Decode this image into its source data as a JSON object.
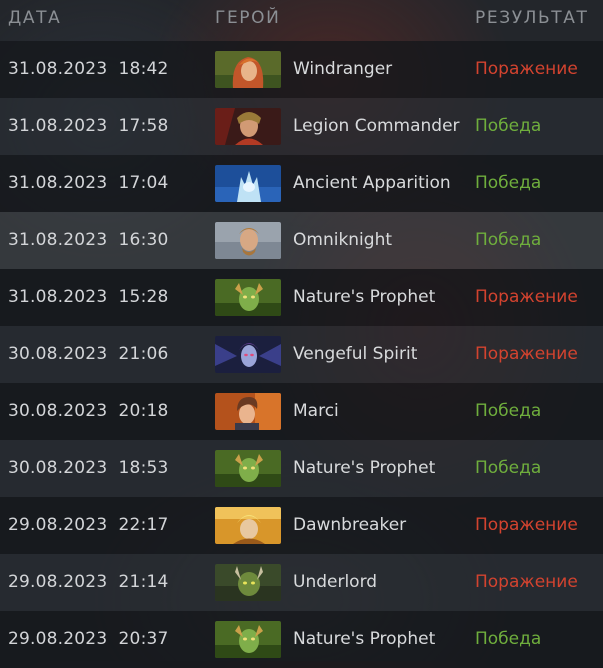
{
  "header": {
    "date": "ДАТА",
    "hero": "ГЕРОЙ",
    "result": "РЕЗУЛЬТАТ"
  },
  "colors": {
    "win": "#6fae3d",
    "loss": "#d3432f"
  },
  "matches": [
    {
      "date": "31.08.2023  18:42",
      "hero": "Windranger",
      "hero_icon": "windranger-portrait-icon",
      "result": "Поражение",
      "outcome": "loss"
    },
    {
      "date": "31.08.2023  17:58",
      "hero": "Legion Commander",
      "hero_icon": "legion-commander-portrait-icon",
      "result": "Победа",
      "outcome": "win"
    },
    {
      "date": "31.08.2023  17:04",
      "hero": "Ancient Apparition",
      "hero_icon": "ancient-apparition-portrait-icon",
      "result": "Победа",
      "outcome": "win"
    },
    {
      "date": "31.08.2023  16:30",
      "hero": "Omniknight",
      "hero_icon": "omniknight-portrait-icon",
      "result": "Победа",
      "outcome": "win"
    },
    {
      "date": "31.08.2023  15:28",
      "hero": "Nature's Prophet",
      "hero_icon": "natures-prophet-portrait-icon",
      "result": "Поражение",
      "outcome": "loss"
    },
    {
      "date": "30.08.2023  21:06",
      "hero": "Vengeful Spirit",
      "hero_icon": "vengeful-spirit-portrait-icon",
      "result": "Поражение",
      "outcome": "loss"
    },
    {
      "date": "30.08.2023  20:18",
      "hero": "Marci",
      "hero_icon": "marci-portrait-icon",
      "result": "Победа",
      "outcome": "win"
    },
    {
      "date": "30.08.2023  18:53",
      "hero": "Nature's Prophet",
      "hero_icon": "natures-prophet-portrait-icon",
      "result": "Победа",
      "outcome": "win"
    },
    {
      "date": "29.08.2023  22:17",
      "hero": "Dawnbreaker",
      "hero_icon": "dawnbreaker-portrait-icon",
      "result": "Поражение",
      "outcome": "loss"
    },
    {
      "date": "29.08.2023  21:14",
      "hero": "Underlord",
      "hero_icon": "underlord-portrait-icon",
      "result": "Поражение",
      "outcome": "loss"
    },
    {
      "date": "29.08.2023  20:37",
      "hero": "Nature's Prophet",
      "hero_icon": "natures-prophet-portrait-icon",
      "result": "Победа",
      "outcome": "win"
    }
  ]
}
